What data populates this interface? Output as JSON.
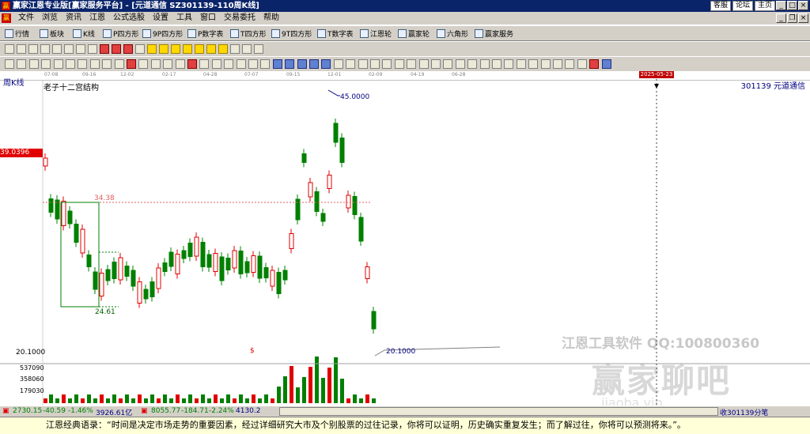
{
  "window": {
    "logo": "赢",
    "title": "赢家江恩专业版[赢家服务平台] - [元道通信  SZ301139-110周K线]",
    "links": [
      "客服",
      "论坛",
      "主页"
    ]
  },
  "menu": {
    "logo": "赢",
    "items": [
      "文件",
      "浏览",
      "资讯",
      "江恩",
      "公式选股",
      "设置",
      "工具",
      "窗口",
      "交易委托",
      "帮助"
    ]
  },
  "toolbar1": {
    "items": [
      "行情",
      "板块",
      "K线",
      "P四方形",
      "9P四方形",
      "P数字表",
      "T四方形",
      "9T四方形",
      "T数字表",
      "江恩轮",
      "赢家轮",
      "六角形",
      "赢家服务"
    ]
  },
  "chart": {
    "period": "周K线",
    "code_label": "301139  元道通信",
    "study_label": "老子十二宫结构",
    "price_tag": "39.0396",
    "date_tag": "2025-05-23",
    "dates": [
      "07-08",
      "09-16",
      "12-02",
      "02-17",
      "04-28",
      "07-07",
      "09-15",
      "12-01",
      "02-09",
      "04-19",
      "06-28"
    ],
    "annotations": {
      "high": "45.0000",
      "level1": "34.38",
      "level2": "24.61",
      "low": "20.1000",
      "low_axis": "20.1000"
    },
    "volume_ticks": [
      "537090",
      "358060",
      "179030"
    ],
    "marker": "$"
  },
  "watermark": {
    "line1": "江恩工具软件   QQ:100800360",
    "line2": "赢家聊吧",
    "line3": "jiaoba.vip"
  },
  "statusbar": {
    "sh": "2730.15",
    "sh_chg": "-40.59",
    "sh_pct": "-1.46%",
    "sh_amt": "3926.61亿",
    "sz": "8055.77",
    "sz_chg": "-184.71",
    "sz_pct": "-2.24%",
    "sz_amt": "4130.2",
    "right_text": "收301139分笔"
  },
  "footer": {
    "quote": "江恩经典语录：“时间是决定市场走势的重要因素，经过详细研究大市及个别股票的过往记录，你将可以证明，历史确实重复发生；而了解过往，你将可以预测将来。”。"
  },
  "colors": {
    "up": "#e00000",
    "down": "#008000",
    "titlebar": "#0a246a"
  }
}
